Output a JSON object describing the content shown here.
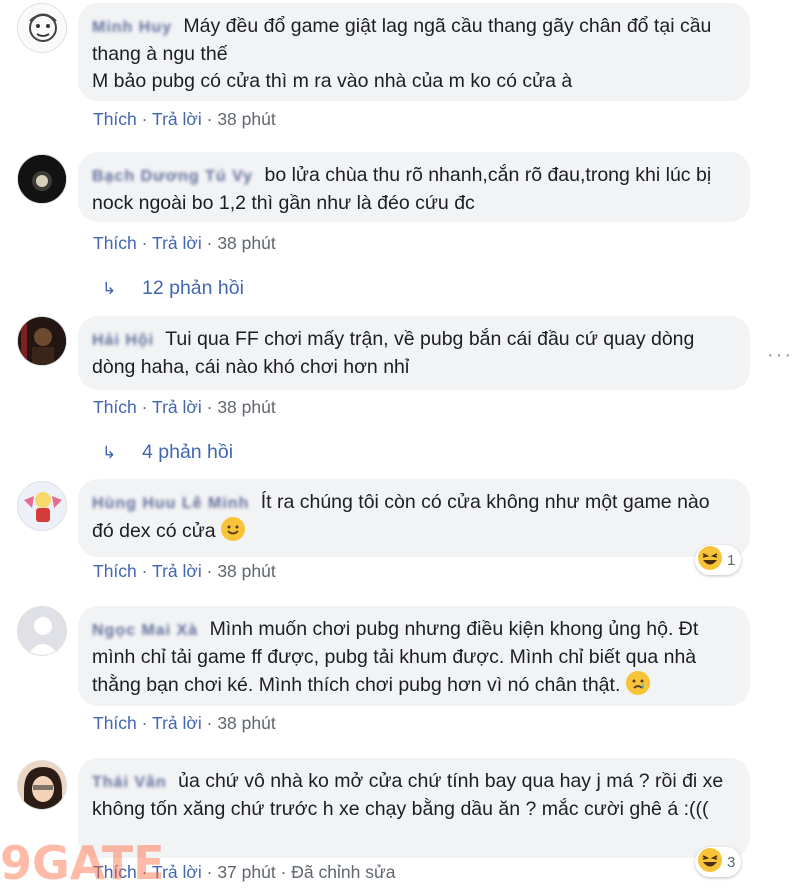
{
  "comments": [
    {
      "author": "Minh Huy",
      "text": "Máy đều đổ game giật lag ngã cầu thang gãy chân đổ tại cầu thang à ngu thế\nM bảo pubg có cửa thì m ra vào nhà của m ko có cửa à",
      "like": "Thích",
      "reply": "Trả lời",
      "time": "38 phút"
    },
    {
      "author": "Bạch Dương Tú Vy",
      "text": "bo lửa chùa thu rõ nhanh,cắn rõ đau,trong khi lúc bị nock ngoài bo 1,2 thì gần như là đéo cứu đc",
      "like": "Thích",
      "reply": "Trả lời",
      "time": "38 phút",
      "replies": "12 phản hồi"
    },
    {
      "author": "Hải Hội",
      "text": "Tui qua FF chơi mấy trận, về pubg bắn cái đầu cứ quay dòng dòng haha, cái nào khó chơi hơn nhỉ",
      "like": "Thích",
      "reply": "Trả lời",
      "time": "38 phút",
      "replies": "4 phản hồi"
    },
    {
      "author": "Hùng Huu Lê Minh",
      "text": "Ít ra chúng tôi còn có cửa không như một game nào đó dex có cửa",
      "like": "Thích",
      "reply": "Trả lời",
      "time": "38 phút",
      "reaction_count": "1"
    },
    {
      "author": "Ngọc Mai Xà",
      "text": "Mình muốn chơi pubg nhưng điều kiện khong ủng hộ. Đt mình chỉ tải game ff được, pubg tải khum được. Mình chỉ biết qua nhà thằng bạn chơi ké. Mình thích chơi pubg hơn vì nó chân thật.",
      "like": "Thích",
      "reply": "Trả lời",
      "time": "38 phút"
    },
    {
      "author": "Thái Vân",
      "text": "ủa chứ vô nhà ko mở cửa chứ tính bay qua hay j má ? rồi đi xe không tốn xăng chứ trước h xe chạy bằng dầu ăn ? mắc cười ghê á :(((",
      "like": "Thích",
      "reply": "Trả lời",
      "time": "37 phút",
      "edited": "Đã chỉnh sửa",
      "reaction_count": "3"
    }
  ],
  "separator": "·",
  "watermark": "9GATE"
}
